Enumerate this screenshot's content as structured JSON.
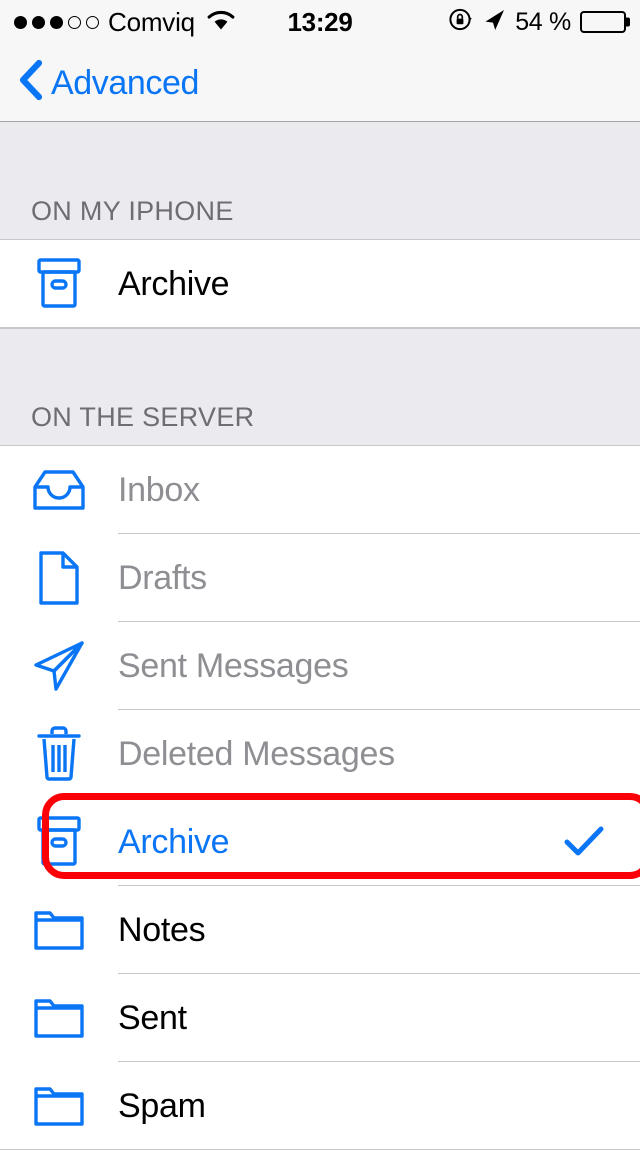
{
  "status_bar": {
    "signal_dots_filled": 3,
    "signal_dots_total": 5,
    "carrier": "Comviq",
    "wifi_icon": "wifi-icon",
    "time": "13:29",
    "rotation_lock_icon": "rotation-lock-icon",
    "location_icon": "location-arrow-icon",
    "battery_percent": "54 %",
    "battery_level": 54,
    "battery_icon": "battery-icon"
  },
  "nav_bar": {
    "back_icon": "chevron-left-icon",
    "back_label": "Advanced"
  },
  "sections": [
    {
      "header": "ON MY IPHONE",
      "rows": [
        {
          "label": "Archive",
          "icon": "archive-box-icon",
          "state": "enabled",
          "checked": false
        }
      ]
    },
    {
      "header": "ON THE SERVER",
      "rows": [
        {
          "label": "Inbox",
          "icon": "inbox-tray-icon",
          "state": "disabled",
          "checked": false
        },
        {
          "label": "Drafts",
          "icon": "document-page-icon",
          "state": "disabled",
          "checked": false
        },
        {
          "label": "Sent Messages",
          "icon": "paper-plane-icon",
          "state": "disabled",
          "checked": false
        },
        {
          "label": "Deleted Messages",
          "icon": "trash-can-icon",
          "state": "disabled",
          "checked": false
        },
        {
          "label": "Archive",
          "icon": "archive-box-icon",
          "state": "selected",
          "checked": true
        },
        {
          "label": "Notes",
          "icon": "folder-icon",
          "state": "enabled",
          "checked": false
        },
        {
          "label": "Sent",
          "icon": "folder-icon",
          "state": "enabled",
          "checked": false
        },
        {
          "label": "Spam",
          "icon": "folder-icon",
          "state": "enabled",
          "checked": false
        }
      ]
    }
  ],
  "annotation": {
    "target_row_label": "Archive",
    "color": "#fb0007",
    "shape": "rounded-rectangle"
  },
  "colors": {
    "accent_blue": "#0a76f6",
    "disabled_gray": "#8e8e93",
    "section_header_text": "#6d6d72",
    "section_header_bg": "#eaeaef",
    "separator": "#c8c7cc",
    "navbar_bg": "#f7f7f7",
    "annotation_red": "#fb0007"
  }
}
